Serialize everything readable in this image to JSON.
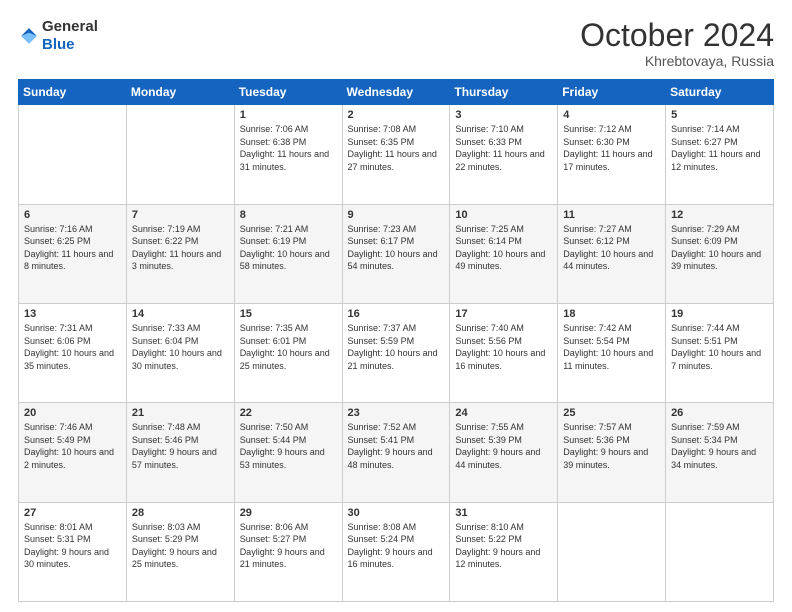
{
  "logo": {
    "general": "General",
    "blue": "Blue"
  },
  "header": {
    "month": "October 2024",
    "location": "Khrebtovaya, Russia"
  },
  "weekdays": [
    "Sunday",
    "Monday",
    "Tuesday",
    "Wednesday",
    "Thursday",
    "Friday",
    "Saturday"
  ],
  "weeks": [
    [
      {
        "day": "",
        "sunrise": "",
        "sunset": "",
        "daylight": ""
      },
      {
        "day": "",
        "sunrise": "",
        "sunset": "",
        "daylight": ""
      },
      {
        "day": "1",
        "sunrise": "Sunrise: 7:06 AM",
        "sunset": "Sunset: 6:38 PM",
        "daylight": "Daylight: 11 hours and 31 minutes."
      },
      {
        "day": "2",
        "sunrise": "Sunrise: 7:08 AM",
        "sunset": "Sunset: 6:35 PM",
        "daylight": "Daylight: 11 hours and 27 minutes."
      },
      {
        "day": "3",
        "sunrise": "Sunrise: 7:10 AM",
        "sunset": "Sunset: 6:33 PM",
        "daylight": "Daylight: 11 hours and 22 minutes."
      },
      {
        "day": "4",
        "sunrise": "Sunrise: 7:12 AM",
        "sunset": "Sunset: 6:30 PM",
        "daylight": "Daylight: 11 hours and 17 minutes."
      },
      {
        "day": "5",
        "sunrise": "Sunrise: 7:14 AM",
        "sunset": "Sunset: 6:27 PM",
        "daylight": "Daylight: 11 hours and 12 minutes."
      }
    ],
    [
      {
        "day": "6",
        "sunrise": "Sunrise: 7:16 AM",
        "sunset": "Sunset: 6:25 PM",
        "daylight": "Daylight: 11 hours and 8 minutes."
      },
      {
        "day": "7",
        "sunrise": "Sunrise: 7:19 AM",
        "sunset": "Sunset: 6:22 PM",
        "daylight": "Daylight: 11 hours and 3 minutes."
      },
      {
        "day": "8",
        "sunrise": "Sunrise: 7:21 AM",
        "sunset": "Sunset: 6:19 PM",
        "daylight": "Daylight: 10 hours and 58 minutes."
      },
      {
        "day": "9",
        "sunrise": "Sunrise: 7:23 AM",
        "sunset": "Sunset: 6:17 PM",
        "daylight": "Daylight: 10 hours and 54 minutes."
      },
      {
        "day": "10",
        "sunrise": "Sunrise: 7:25 AM",
        "sunset": "Sunset: 6:14 PM",
        "daylight": "Daylight: 10 hours and 49 minutes."
      },
      {
        "day": "11",
        "sunrise": "Sunrise: 7:27 AM",
        "sunset": "Sunset: 6:12 PM",
        "daylight": "Daylight: 10 hours and 44 minutes."
      },
      {
        "day": "12",
        "sunrise": "Sunrise: 7:29 AM",
        "sunset": "Sunset: 6:09 PM",
        "daylight": "Daylight: 10 hours and 39 minutes."
      }
    ],
    [
      {
        "day": "13",
        "sunrise": "Sunrise: 7:31 AM",
        "sunset": "Sunset: 6:06 PM",
        "daylight": "Daylight: 10 hours and 35 minutes."
      },
      {
        "day": "14",
        "sunrise": "Sunrise: 7:33 AM",
        "sunset": "Sunset: 6:04 PM",
        "daylight": "Daylight: 10 hours and 30 minutes."
      },
      {
        "day": "15",
        "sunrise": "Sunrise: 7:35 AM",
        "sunset": "Sunset: 6:01 PM",
        "daylight": "Daylight: 10 hours and 25 minutes."
      },
      {
        "day": "16",
        "sunrise": "Sunrise: 7:37 AM",
        "sunset": "Sunset: 5:59 PM",
        "daylight": "Daylight: 10 hours and 21 minutes."
      },
      {
        "day": "17",
        "sunrise": "Sunrise: 7:40 AM",
        "sunset": "Sunset: 5:56 PM",
        "daylight": "Daylight: 10 hours and 16 minutes."
      },
      {
        "day": "18",
        "sunrise": "Sunrise: 7:42 AM",
        "sunset": "Sunset: 5:54 PM",
        "daylight": "Daylight: 10 hours and 11 minutes."
      },
      {
        "day": "19",
        "sunrise": "Sunrise: 7:44 AM",
        "sunset": "Sunset: 5:51 PM",
        "daylight": "Daylight: 10 hours and 7 minutes."
      }
    ],
    [
      {
        "day": "20",
        "sunrise": "Sunrise: 7:46 AM",
        "sunset": "Sunset: 5:49 PM",
        "daylight": "Daylight: 10 hours and 2 minutes."
      },
      {
        "day": "21",
        "sunrise": "Sunrise: 7:48 AM",
        "sunset": "Sunset: 5:46 PM",
        "daylight": "Daylight: 9 hours and 57 minutes."
      },
      {
        "day": "22",
        "sunrise": "Sunrise: 7:50 AM",
        "sunset": "Sunset: 5:44 PM",
        "daylight": "Daylight: 9 hours and 53 minutes."
      },
      {
        "day": "23",
        "sunrise": "Sunrise: 7:52 AM",
        "sunset": "Sunset: 5:41 PM",
        "daylight": "Daylight: 9 hours and 48 minutes."
      },
      {
        "day": "24",
        "sunrise": "Sunrise: 7:55 AM",
        "sunset": "Sunset: 5:39 PM",
        "daylight": "Daylight: 9 hours and 44 minutes."
      },
      {
        "day": "25",
        "sunrise": "Sunrise: 7:57 AM",
        "sunset": "Sunset: 5:36 PM",
        "daylight": "Daylight: 9 hours and 39 minutes."
      },
      {
        "day": "26",
        "sunrise": "Sunrise: 7:59 AM",
        "sunset": "Sunset: 5:34 PM",
        "daylight": "Daylight: 9 hours and 34 minutes."
      }
    ],
    [
      {
        "day": "27",
        "sunrise": "Sunrise: 8:01 AM",
        "sunset": "Sunset: 5:31 PM",
        "daylight": "Daylight: 9 hours and 30 minutes."
      },
      {
        "day": "28",
        "sunrise": "Sunrise: 8:03 AM",
        "sunset": "Sunset: 5:29 PM",
        "daylight": "Daylight: 9 hours and 25 minutes."
      },
      {
        "day": "29",
        "sunrise": "Sunrise: 8:06 AM",
        "sunset": "Sunset: 5:27 PM",
        "daylight": "Daylight: 9 hours and 21 minutes."
      },
      {
        "day": "30",
        "sunrise": "Sunrise: 8:08 AM",
        "sunset": "Sunset: 5:24 PM",
        "daylight": "Daylight: 9 hours and 16 minutes."
      },
      {
        "day": "31",
        "sunrise": "Sunrise: 8:10 AM",
        "sunset": "Sunset: 5:22 PM",
        "daylight": "Daylight: 9 hours and 12 minutes."
      },
      {
        "day": "",
        "sunrise": "",
        "sunset": "",
        "daylight": ""
      },
      {
        "day": "",
        "sunrise": "",
        "sunset": "",
        "daylight": ""
      }
    ]
  ]
}
